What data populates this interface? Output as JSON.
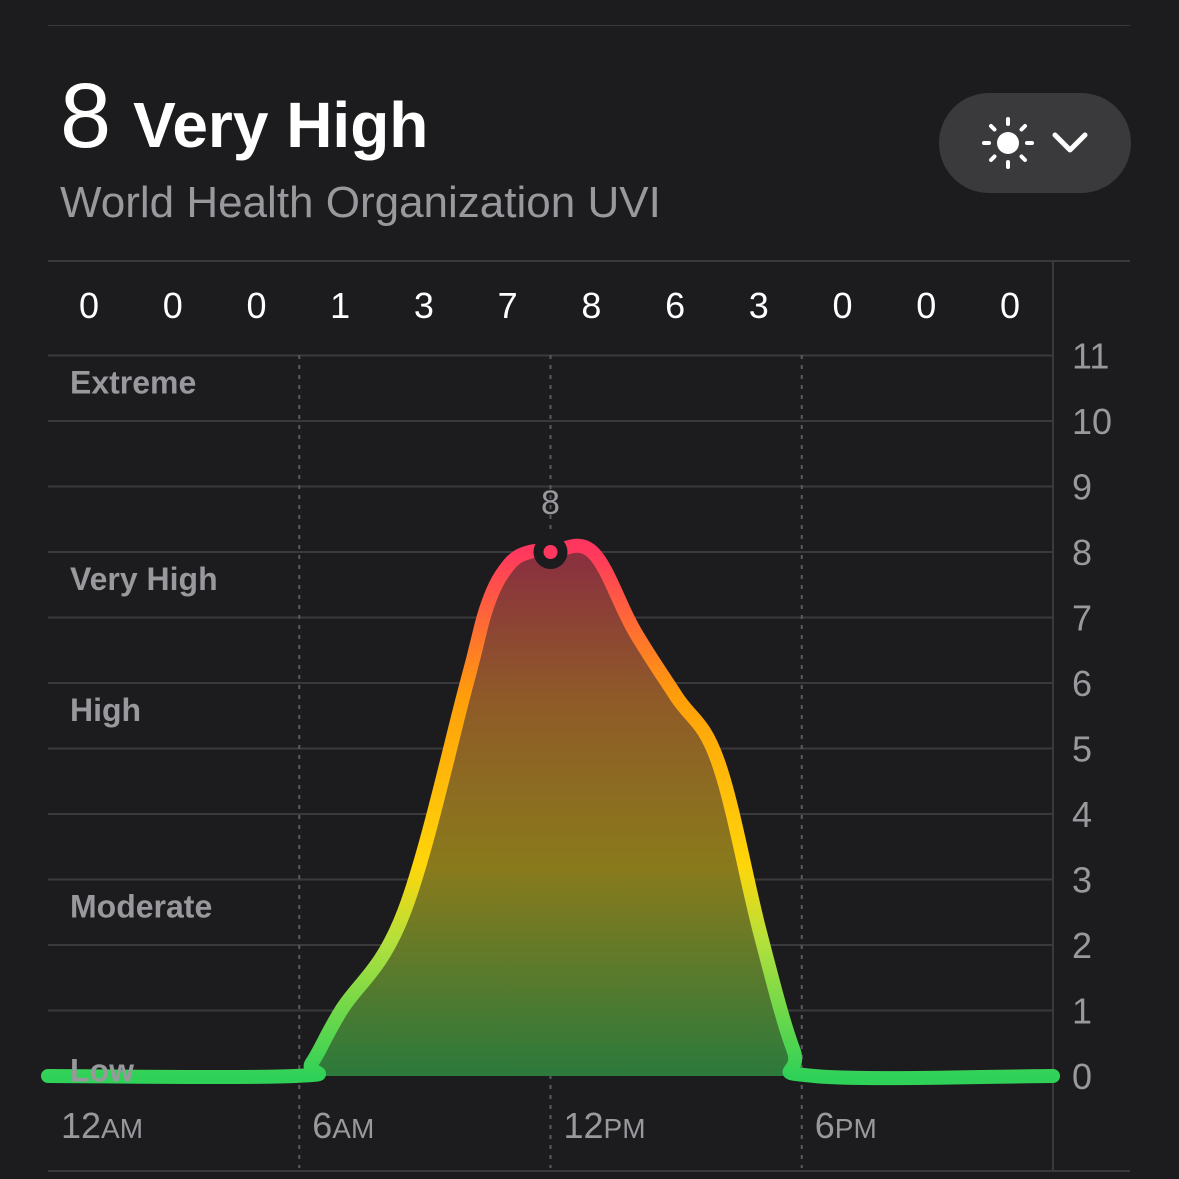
{
  "header": {
    "uv_value": "8",
    "uv_level": "Very High",
    "source": "World Health Organization UVI"
  },
  "picker": {
    "icon": "sun-icon",
    "chevron": "chevron-down-icon"
  },
  "colors": {
    "background": "#1c1c1e",
    "grid": "#3a3a3c",
    "text_secondary": "#98989d",
    "low": "#30d158",
    "moderate": "#ffd60a",
    "high": "#ff9f0a",
    "very_high": "#ff375f"
  },
  "chart_data": {
    "type": "area",
    "hourly_labels": [
      "0",
      "0",
      "0",
      "1",
      "3",
      "7",
      "8",
      "6",
      "3",
      "0",
      "0",
      "0"
    ],
    "x_ticks": [
      {
        "hour": 0,
        "num": "12",
        "ampm": "AM"
      },
      {
        "hour": 6,
        "num": "6",
        "ampm": "AM"
      },
      {
        "hour": 12,
        "num": "12",
        "ampm": "PM"
      },
      {
        "hour": 18,
        "num": "6",
        "ampm": "PM"
      }
    ],
    "y_ticks": [
      "0",
      "1",
      "2",
      "3",
      "4",
      "5",
      "6",
      "7",
      "8",
      "9",
      "10",
      "11"
    ],
    "ylim": [
      0,
      11
    ],
    "xlim": [
      0,
      24
    ],
    "categories": [
      {
        "label": "Extreme",
        "value": 11
      },
      {
        "label": "Very High",
        "value": 8
      },
      {
        "label": "High",
        "value": 6
      },
      {
        "label": "Moderate",
        "value": 3
      },
      {
        "label": "Low",
        "value": 0.5
      }
    ],
    "series": [
      {
        "x": [
          0,
          5.9,
          6.3,
          7,
          8.5,
          10,
          10.5,
          11,
          11.5,
          12,
          13,
          14,
          15,
          16,
          17,
          17.8,
          18.3,
          24
        ],
        "y": [
          0,
          0,
          0.2,
          1,
          2.5,
          6,
          7.2,
          7.8,
          8,
          8,
          8,
          6.8,
          5.8,
          4.8,
          2.2,
          0.4,
          0,
          0
        ]
      }
    ],
    "current": {
      "x": 12,
      "y": 8,
      "label": "8"
    },
    "grid": true
  }
}
